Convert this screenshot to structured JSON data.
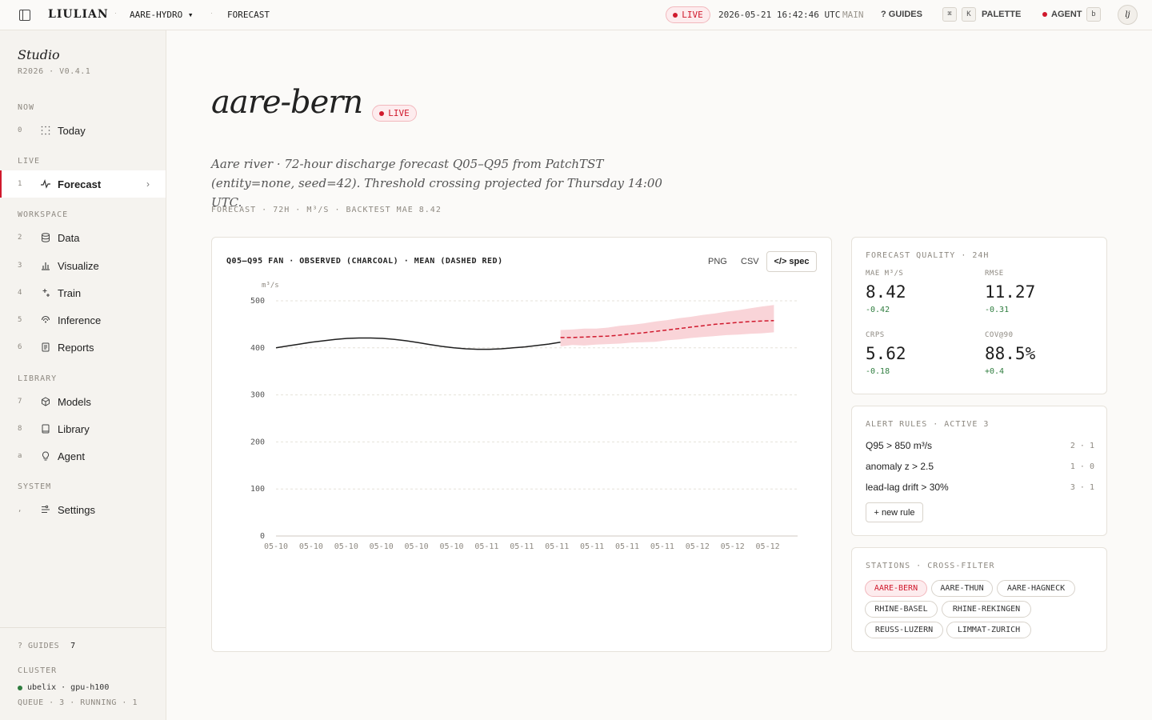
{
  "topbar": {
    "logo": "LIULIAN",
    "project": "AARE-HYDRO ▾",
    "page": "FORECAST",
    "live": "LIVE",
    "timestamp": "2026-05-21 16:42:46 UTC",
    "branch": "MAIN",
    "guides": "? GUIDES",
    "kbd_cmd": "⌘",
    "kbd_k": "K",
    "palette": "PALETTE",
    "agent": "AGENT",
    "kbd_b": "b",
    "avatar": "lj"
  },
  "sidebar": {
    "title": "Studio",
    "version": "R2026 · V0.4.1",
    "sections": {
      "now": "NOW",
      "live": "LIVE",
      "workspace": "WORKSPACE",
      "library": "LIBRARY",
      "system": "SYSTEM"
    },
    "items": [
      {
        "key": "0",
        "label": "Today",
        "icon": "grid-dots-icon"
      },
      {
        "key": "1",
        "label": "Forecast",
        "icon": "pulse-icon",
        "active": true
      },
      {
        "key": "2",
        "label": "Data",
        "icon": "database-icon"
      },
      {
        "key": "3",
        "label": "Visualize",
        "icon": "bar-chart-icon"
      },
      {
        "key": "4",
        "label": "Train",
        "icon": "sparkle-icon"
      },
      {
        "key": "5",
        "label": "Inference",
        "icon": "signal-icon"
      },
      {
        "key": "6",
        "label": "Reports",
        "icon": "document-icon"
      },
      {
        "key": "7",
        "label": "Models",
        "icon": "cube-icon"
      },
      {
        "key": "8",
        "label": "Library",
        "icon": "book-icon"
      },
      {
        "key": "a",
        "label": "Agent",
        "icon": "bulb-icon"
      },
      {
        "key": ",",
        "label": "Settings",
        "icon": "sliders-icon"
      }
    ],
    "footer": {
      "guides_label": "? GUIDES",
      "guides_count": "7",
      "cluster_label": "CLUSTER",
      "host": "ubelix · gpu-h100",
      "queue": "QUEUE · 3 · RUNNING · 1"
    }
  },
  "main": {
    "title": "aare-bern",
    "live": "LIVE",
    "description": "Aare river · 72-hour discharge forecast Q05–Q95 from PatchTST (entity=none, seed=42). Threshold crossing projected for Thursday 14:00 UTC.",
    "meta": "FORECAST · 72H · M³/S · BACKTEST MAE 8.42"
  },
  "chart_card": {
    "title": "Q05–Q95 FAN · OBSERVED (CHARCOAL) · MEAN (DASHED RED)",
    "png": "PNG",
    "csv": "CSV",
    "spec": "</> spec"
  },
  "chart_data": {
    "type": "line",
    "title": "Q05–Q95 FAN · OBSERVED (CHARCOAL) · MEAN (DASHED RED)",
    "ylabel": "m³/s",
    "xlabel": "",
    "ylim": [
      0,
      500
    ],
    "yticks": [
      0,
      100,
      200,
      300,
      400,
      500
    ],
    "xticks": [
      "05-10",
      "05-10",
      "05-10",
      "05-10",
      "05-10",
      "05-10",
      "05-11",
      "05-11",
      "05-11",
      "05-11",
      "05-11",
      "05-11",
      "05-12",
      "05-12",
      "05-12"
    ],
    "grid": true,
    "colors": {
      "observed": "#1e1e1e",
      "mean": "#d0192d",
      "band": "#f7c6cb"
    },
    "series": [
      {
        "name": "OBSERVED",
        "t": [
          0,
          4,
          8,
          12,
          16,
          20,
          24,
          28,
          32,
          36,
          40,
          44,
          48,
          52,
          56,
          60,
          64,
          68,
          72,
          76,
          80,
          84,
          88,
          92,
          96
        ],
        "values": [
          400,
          404,
          408,
          412,
          415,
          418,
          420,
          421,
          421,
          420,
          418,
          415,
          411,
          407,
          403,
          400,
          398,
          397,
          397,
          398,
          400,
          402,
          405,
          408,
          412
        ]
      },
      {
        "name": "MEAN",
        "t": [
          96,
          100,
          104,
          108,
          112,
          116,
          120,
          124,
          128,
          132,
          136,
          140,
          144,
          148,
          152,
          156,
          160,
          164,
          168
        ],
        "values": [
          422,
          422,
          423,
          424,
          425,
          427,
          430,
          432,
          435,
          438,
          441,
          444,
          447,
          450,
          452,
          454,
          456,
          457,
          458
        ]
      },
      {
        "name": "Q95",
        "t": [
          96,
          100,
          104,
          108,
          112,
          116,
          120,
          124,
          128,
          132,
          136,
          140,
          144,
          148,
          152,
          156,
          160,
          164,
          168
        ],
        "values": [
          438,
          439,
          441,
          441,
          443,
          447,
          449,
          452,
          456,
          459,
          463,
          466,
          470,
          473,
          477,
          480,
          484,
          488,
          491
        ]
      },
      {
        "name": "Q05",
        "t": [
          96,
          100,
          104,
          108,
          112,
          116,
          120,
          124,
          128,
          132,
          136,
          140,
          144,
          148,
          152,
          156,
          160,
          164,
          168
        ],
        "values": [
          403,
          406,
          405,
          407,
          408,
          409,
          411,
          412,
          413,
          416,
          418,
          421,
          423,
          425,
          427,
          428,
          430,
          431,
          433
        ]
      }
    ],
    "t_range": [
      0,
      176
    ]
  },
  "quality": {
    "header": "FORECAST QUALITY · 24H",
    "metrics": [
      {
        "label": "MAE M³/S",
        "value": "8.42",
        "delta": "-0.42"
      },
      {
        "label": "RMSE",
        "value": "11.27",
        "delta": "-0.31"
      },
      {
        "label": "CRPS",
        "value": "5.62",
        "delta": "-0.18"
      },
      {
        "label": "COV@90",
        "value": "88.5%",
        "delta": "+0.4"
      }
    ]
  },
  "alerts": {
    "header": "ALERT RULES · ACTIVE 3",
    "rules": [
      {
        "name": "Q95 > 850 m³/s",
        "count": "2 · 1"
      },
      {
        "name": "anomaly z > 2.5",
        "count": "1 · 0"
      },
      {
        "name": "lead-lag drift > 30%",
        "count": "3 · 1"
      }
    ],
    "new_rule": "+ new rule"
  },
  "stations": {
    "header": "STATIONS · CROSS-FILTER",
    "chips": [
      {
        "label": "AARE-BERN",
        "active": true
      },
      {
        "label": "AARE-THUN"
      },
      {
        "label": "AARE-HAGNECK"
      },
      {
        "label": "RHINE-BASEL"
      },
      {
        "label": "RHINE-REKINGEN"
      },
      {
        "label": "REUSS-LUZERN"
      },
      {
        "label": "LIMMAT-ZURICH"
      }
    ]
  }
}
